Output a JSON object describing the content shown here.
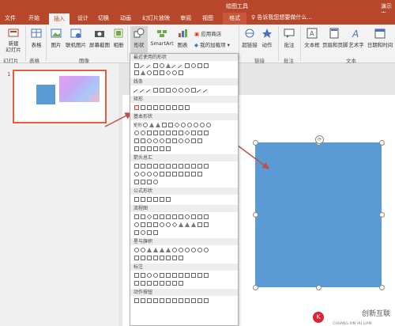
{
  "window": {
    "title_right": "演示文",
    "tool_context": "绘图工具"
  },
  "menu": {
    "tabs": [
      {
        "label": "文件"
      },
      {
        "label": "开始"
      },
      {
        "label": "插入"
      },
      {
        "label": "设计"
      },
      {
        "label": "切换"
      },
      {
        "label": "动画"
      },
      {
        "label": "幻灯片放映"
      },
      {
        "label": "审阅"
      },
      {
        "label": "视图"
      },
      {
        "label": "格式"
      }
    ],
    "search_placeholder": "告诉我您想要做什么..."
  },
  "ribbon": {
    "buttons": {
      "new_slide": "新建\n幻灯片",
      "table": "表格",
      "picture": "图片",
      "online_picture": "联机图片",
      "screenshot": "屏幕截图",
      "album": "相册",
      "shapes": "形状",
      "smartart": "SmartArt",
      "chart": "图表",
      "store": "应用商店",
      "my_addins": "我的加载项",
      "hyperlink": "超链接",
      "action": "动作",
      "comment": "批注",
      "textbox": "文本框",
      "header_footer": "页眉和页脚",
      "wordart": "艺术字",
      "datetime": "日期和时间"
    },
    "groups": {
      "slides": "幻灯片",
      "tables": "表格",
      "images": "图像",
      "links": "链接",
      "comments": "批注",
      "text": "文本"
    }
  },
  "slides_panel": {
    "slide_number": "1"
  },
  "shapes_menu": {
    "sections": [
      {
        "title": "最近使用的形状"
      },
      {
        "title": "线条"
      },
      {
        "title": "矩形"
      },
      {
        "title": "基本形状"
      },
      {
        "title": "箭头总汇"
      },
      {
        "title": "公式形状"
      },
      {
        "title": "流程图"
      },
      {
        "title": "星与旗帜"
      },
      {
        "title": "标注"
      },
      {
        "title": "动作按钮"
      }
    ],
    "basic_label": "矩形"
  },
  "watermark": {
    "text": "创新互联",
    "sub": "CHUANG XIN HU LIAN"
  },
  "colors": {
    "accent": "#b7472a",
    "shape_fill": "#5b9bd5",
    "arrow": "#c0504d"
  }
}
